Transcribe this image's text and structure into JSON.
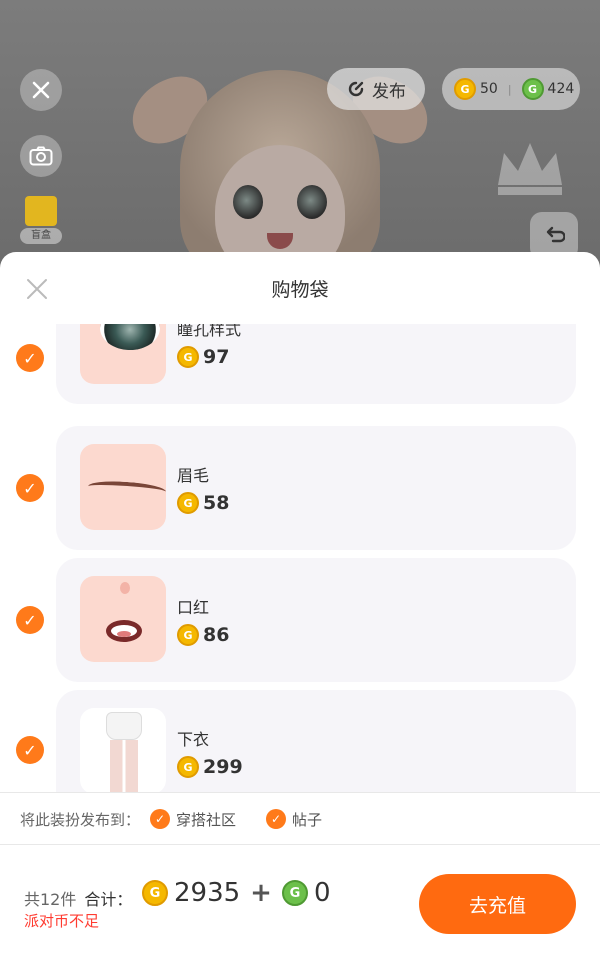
{
  "top_bar": {
    "publish_label": "发布",
    "gold_coins": "50",
    "green_coins": "424",
    "blindbox_label": "盲盒"
  },
  "icons": {
    "close": "close-icon",
    "camera": "camera-icon",
    "publish": "publish-icon",
    "undo": "undo-icon",
    "gold_coin": "gold-coin-icon",
    "green_coin": "green-coin-icon",
    "check": "check-icon",
    "blindbox": "blindbox-icon"
  },
  "colors": {
    "accent": "#ff7a1a",
    "button": "#ff6a10",
    "warning": "#ff3b30",
    "gold": "#f5b800",
    "green": "#6cc04a"
  },
  "sheet": {
    "title": "购物袋",
    "items": [
      {
        "name": "瞳孔样式",
        "price": "97",
        "checked": true
      },
      {
        "name": "眉毛",
        "price": "58",
        "checked": true
      },
      {
        "name": "口红",
        "price": "86",
        "checked": true
      },
      {
        "name": "下衣",
        "price": "299",
        "checked": true
      }
    ]
  },
  "publish_to": {
    "label": "将此装扮发布到：",
    "options": [
      {
        "label": "穿搭社区",
        "checked": true
      },
      {
        "label": "帖子",
        "checked": true
      }
    ]
  },
  "footer": {
    "count": "共12件",
    "total_label": "合计：",
    "gold_total": "2935",
    "green_total": "0",
    "plus": "+",
    "warning": "派对币不足",
    "recharge_label": "去充值"
  }
}
